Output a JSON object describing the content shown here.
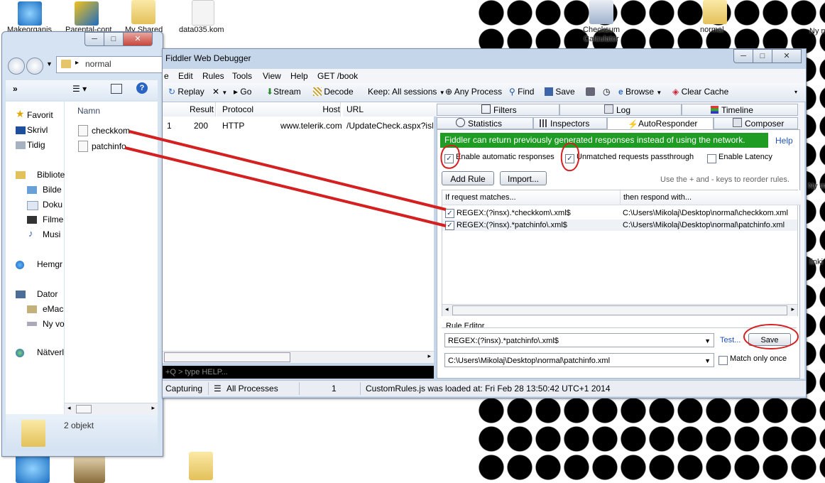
{
  "desktop": {
    "icons": [
      {
        "label": "Makeorganis"
      },
      {
        "label": "Parental-cont"
      },
      {
        "label": "My Shared"
      },
      {
        "label": "data035.kom"
      },
      {
        "label": "Checksum Calculator"
      },
      {
        "label": "normal"
      },
      {
        "label": "Ny m"
      },
      {
        "label": "Ny m"
      },
      {
        "label": "linki"
      }
    ]
  },
  "explorer": {
    "address": "normal",
    "toolbar_overflow": "»",
    "column_header": "Namn",
    "nav": [
      {
        "label": "Favorit",
        "icon": "star-icon"
      },
      {
        "label": "Skrivl",
        "icon": "desktop-icon"
      },
      {
        "label": "Tidig",
        "icon": "recent-icon"
      },
      {
        "label": "Bibliote",
        "icon": "library-icon"
      },
      {
        "label": "Bilde",
        "icon": "pictures-icon"
      },
      {
        "label": "Doku",
        "icon": "documents-icon"
      },
      {
        "label": "Filme",
        "icon": "video-icon"
      },
      {
        "label": "Musi",
        "icon": "music-icon"
      },
      {
        "label": "Hemgr",
        "icon": "homegroup-icon"
      },
      {
        "label": "Dator",
        "icon": "computer-icon"
      },
      {
        "label": "eMac",
        "icon": "drive-icon"
      },
      {
        "label": "Ny vo",
        "icon": "drive-icon"
      },
      {
        "label": "Nätverl",
        "icon": "network-icon"
      }
    ],
    "files": [
      {
        "name": "checkkom"
      },
      {
        "name": "patchinfo"
      }
    ],
    "status": "2 objekt"
  },
  "fiddler": {
    "title": "Fiddler Web Debugger",
    "menu": [
      "e",
      "Edit",
      "Rules",
      "Tools",
      "View",
      "Help",
      "GET /book"
    ],
    "toolbar": {
      "replay": "Replay",
      "go": "Go",
      "stream": "Stream",
      "decode": "Decode",
      "keep": "Keep: All sessions",
      "any_process": "Any Process",
      "find": "Find",
      "save": "Save",
      "browse": "Browse",
      "clear_cache": "Clear Cache"
    },
    "sessions": {
      "columns": [
        "Result",
        "Protocol",
        "Host",
        "URL"
      ],
      "rows": [
        {
          "num": "1",
          "result": "200",
          "protocol": "HTTP",
          "host": "www.telerik.com",
          "url": "/UpdateCheck.aspx?isBet"
        }
      ]
    },
    "quickexec_placeholder": "+Q > type HELP...",
    "statusbar": {
      "capturing": "Capturing",
      "processes": "All Processes",
      "count": "1",
      "message": "CustomRules.js was loaded at: Fri Feb 28 13:50:42 UTC+1 2014"
    },
    "tabs_row1": [
      "Filters",
      "Log",
      "Timeline"
    ],
    "tabs_row2": [
      "Statistics",
      "Inspectors",
      "AutoResponder",
      "Composer"
    ],
    "autoresponder": {
      "banner": "Fiddler can return previously generated responses instead of using the network.",
      "help": "Help",
      "enable_auto": "Enable automatic responses",
      "unmatched": "Unmatched requests passthrough",
      "latency": "Enable Latency",
      "add_rule": "Add Rule",
      "import": "Import...",
      "reorder_hint": "Use the + and - keys to reorder rules.",
      "col_match": "If request matches...",
      "col_respond": "then respond with...",
      "rules": [
        {
          "match": "REGEX:(?insx).*checkkom\\.xml$",
          "respond": "C:\\Users\\Mikolaj\\Desktop\\normal\\checkkom.xml",
          "checked": true
        },
        {
          "match": "REGEX:(?insx).*patchinfo\\.xml$",
          "respond": "C:\\Users\\Mikolaj\\Desktop\\normal\\patchinfo.xml",
          "checked": true
        }
      ],
      "rule_editor_label": "Rule Editor",
      "editor_match": "REGEX:(?insx).*patchinfo\\.xml$",
      "editor_respond": "C:\\Users\\Mikolaj\\Desktop\\normal\\patchinfo.xml",
      "test": "Test...",
      "save": "Save",
      "match_once": "Match only once"
    }
  },
  "colors": {
    "banner_green": "#1e9c23",
    "annotation_red": "#d42020"
  }
}
